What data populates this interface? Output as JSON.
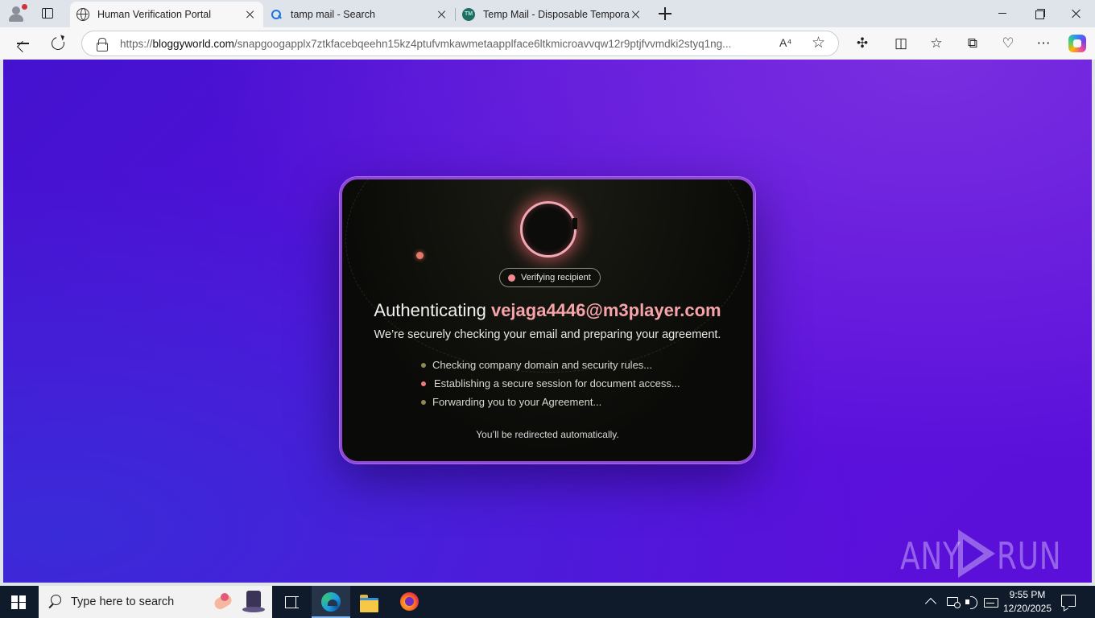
{
  "browser": {
    "tabs": [
      {
        "title": "Human Verification Portal",
        "icon": "globe-icon",
        "active": true
      },
      {
        "title": "tamp mail - Search",
        "icon": "search-icon",
        "active": false
      },
      {
        "title": "Temp Mail - Disposable Temporary",
        "icon": "temp-mail-icon",
        "active": false
      }
    ],
    "address": {
      "scheme": "https://",
      "host": "bloggyworld.com",
      "path": "/snapgoogapplx7ztkfacebqeehn15kz4ptufvmkawmetaapplface6ltkmicroavvqw12r9ptjfvvmdki2styq1ng..."
    },
    "read_aloud_glyph": "A⁴",
    "tmicon_text": "TM"
  },
  "page": {
    "status_pill": "Verifying recipient",
    "headline_prefix": "Authenticating",
    "email": "vejaga4446@m3player.com",
    "subline": "We’re securely checking your email and preparing your agreement.",
    "steps": [
      {
        "text": "Checking company domain and security rules..."
      },
      {
        "text": "Establishing a secure session for document access..."
      },
      {
        "text": "Forwarding you to your Agreement..."
      }
    ],
    "redirect_note": "You’ll be redirected automatically.",
    "watermark_left": "ANY",
    "watermark_right": "RUN",
    "colors": {
      "accent_email": "#f6a4aa",
      "card_border": "#8e48d6",
      "background": "#5a10dc"
    }
  },
  "taskbar": {
    "search_placeholder": "Type here to search",
    "time": "9:55 PM",
    "date": "12/20/2025"
  }
}
